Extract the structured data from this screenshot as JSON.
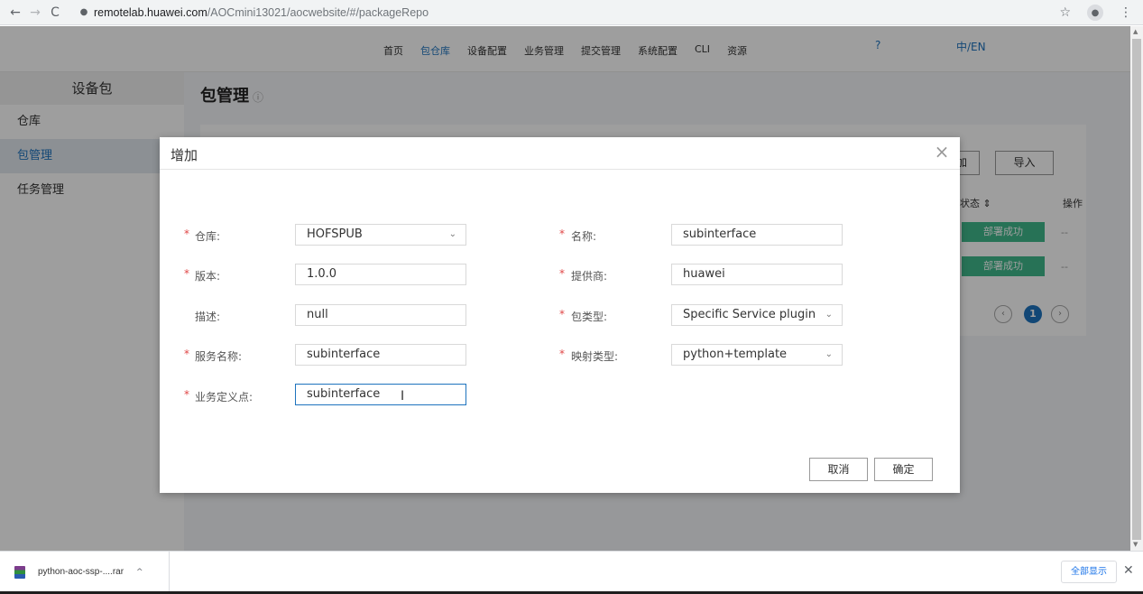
{
  "browser": {
    "back": "←",
    "forward": "→",
    "reload": "C",
    "lock": "🔒",
    "url_host": "remotelab.huawei.com",
    "url_path": "/AOCmini13021/aocwebsite/#/packageRepo",
    "star": "☆",
    "menu": "⋮"
  },
  "header": {
    "nav": [
      "首页",
      "包仓库",
      "设备配置",
      "业务管理",
      "提交管理",
      "系统配置",
      "CLI",
      "资源"
    ],
    "active_nav": "包仓库",
    "help": "?",
    "lang": "中/EN"
  },
  "sidebar": {
    "title": "设备包",
    "items": [
      {
        "label": "仓库",
        "active": false
      },
      {
        "label": "包管理",
        "active": true
      },
      {
        "label": "任务管理",
        "active": false
      }
    ]
  },
  "main": {
    "title": "包管理",
    "info_icon": "ⓘ",
    "btn_add_partial": "加",
    "btn_import": "导入",
    "col_status": "状态 ⇕",
    "col_ops": "操作",
    "rows": [
      {
        "status": "部署成功",
        "op": "--"
      },
      {
        "status": "部署成功",
        "op": "--"
      }
    ],
    "pager": {
      "prev": "‹",
      "current": "1",
      "next": "›"
    }
  },
  "modal": {
    "title": "增加",
    "fields": {
      "repo": {
        "label": "仓库:",
        "value": "HOFSPUB",
        "required": true
      },
      "name": {
        "label": "名称:",
        "value": "subinterface",
        "required": true
      },
      "version": {
        "label": "版本:",
        "value": "1.0.0",
        "required": true
      },
      "vendor": {
        "label": "提供商:",
        "value": "huawei",
        "required": true
      },
      "desc": {
        "label": "描述:",
        "value": "null",
        "required": false
      },
      "pkg_type": {
        "label": "包类型:",
        "value": "Specific Service plugin",
        "required": true
      },
      "service_name": {
        "label": "服务名称:",
        "value": "subinterface",
        "required": true
      },
      "map_type": {
        "label": "映射类型:",
        "value": "python+template",
        "required": true
      },
      "biz_point": {
        "label": "业务定义点:",
        "value": "subinterface",
        "required": true
      }
    },
    "cancel": "取消",
    "ok": "确定"
  },
  "downloads": {
    "file": "python-aoc-ssp-....rar",
    "show_all": "全部显示",
    "close": "✕"
  }
}
